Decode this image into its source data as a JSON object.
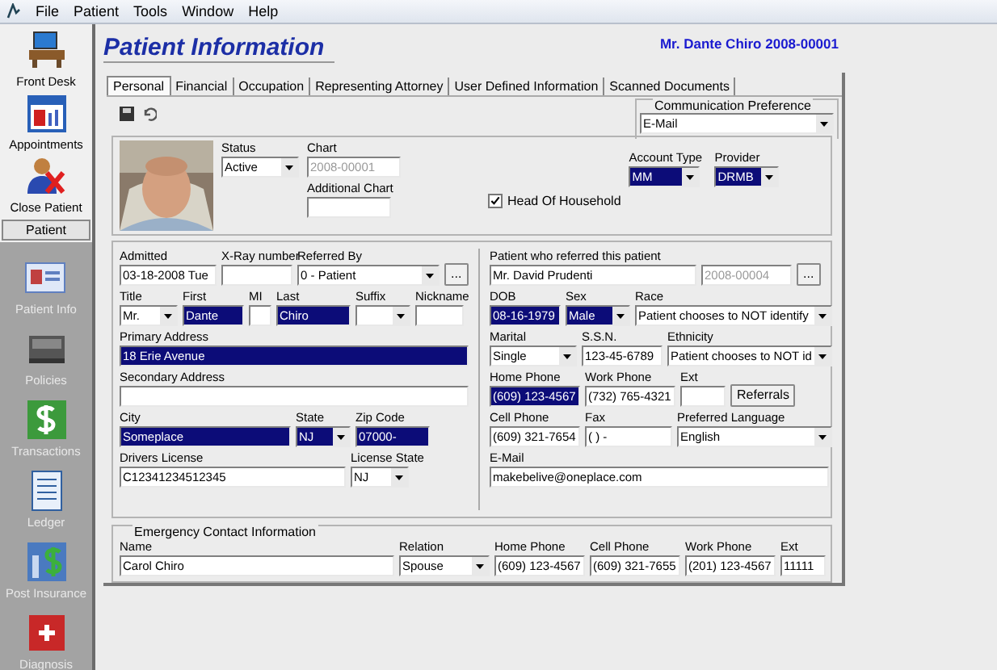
{
  "menu": [
    "File",
    "Patient",
    "Tools",
    "Window",
    "Help"
  ],
  "sidebar": {
    "top_items": [
      {
        "label": "Front Desk"
      },
      {
        "label": "Appointments"
      },
      {
        "label": "Close Patient"
      }
    ],
    "section": "Patient",
    "items": [
      {
        "label": "Patient Info"
      },
      {
        "label": "Policies"
      },
      {
        "label": "Transactions"
      },
      {
        "label": "Ledger"
      },
      {
        "label": "Post Insurance"
      },
      {
        "label": "Diagnosis"
      }
    ]
  },
  "header": {
    "title": "Patient Information",
    "patient": "Mr. Dante Chiro 2008-00001"
  },
  "tabs": [
    {
      "label": "Personal",
      "selected": true
    },
    {
      "label": "Financial",
      "selected": false
    },
    {
      "label": "Occupation",
      "selected": false
    },
    {
      "label": "Representing Attorney",
      "selected": false
    },
    {
      "label": "User Defined Information",
      "selected": false
    },
    {
      "label": "Scanned Documents",
      "selected": false
    }
  ],
  "communication_preference": {
    "label": "Communication Preference",
    "value": "E-Mail"
  },
  "profile": {
    "status": {
      "kind": "select",
      "label": "Status",
      "value": "Active"
    },
    "chart": {
      "kind": "text",
      "label": "Chart",
      "value": "2008-00001",
      "readonly": true
    },
    "additional_chart": {
      "kind": "text",
      "label": "Additional Chart"
    },
    "head_of_household": {
      "label": "Head Of Household",
      "checked": true
    },
    "account_type": {
      "kind": "select",
      "label": "Account Type",
      "value": "MM",
      "highlighted": true
    },
    "provider": {
      "kind": "select",
      "label": "Provider",
      "value": "DRMB",
      "highlighted": true
    }
  },
  "referral_left": [
    {
      "kind": "text",
      "label": "Admitted",
      "value": "03-18-2008 Tue"
    },
    {
      "kind": "text",
      "label": "X-Ray number"
    },
    {
      "kind": "select",
      "label": "Referred By",
      "value": "0 - Patient"
    },
    {
      "kind": "button",
      "text": "..."
    }
  ],
  "referral_right": [
    {
      "kind": "text",
      "label": "Patient who referred this patient",
      "value": "Mr. David Prudenti"
    },
    {
      "kind": "text",
      "value": "2008-00004",
      "readonly": true
    },
    {
      "kind": "button",
      "text": "..."
    }
  ],
  "left_rows": [
    [
      {
        "kind": "select",
        "label": "Title",
        "value": "Mr."
      },
      {
        "kind": "text",
        "label": "First",
        "value": "Dante",
        "highlighted": true
      },
      {
        "kind": "text",
        "label": "MI"
      },
      {
        "kind": "text",
        "label": "Last",
        "value": "Chiro",
        "highlighted": true
      },
      {
        "kind": "select",
        "label": "Suffix"
      },
      {
        "kind": "text",
        "label": "Nickname"
      }
    ],
    [
      {
        "kind": "text",
        "label": "Primary Address",
        "value": "18 Erie Avenue",
        "highlighted": true
      }
    ],
    [
      {
        "kind": "text",
        "label": "Secondary Address"
      }
    ],
    [
      {
        "kind": "text",
        "label": "City",
        "value": "Someplace",
        "highlighted": true
      },
      {
        "kind": "select",
        "label": "State",
        "value": "NJ",
        "highlighted": true
      },
      {
        "kind": "text",
        "label": "Zip Code",
        "value": "07000-",
        "highlighted": true
      }
    ],
    [
      {
        "kind": "text",
        "label": "Drivers License",
        "value": "C12341234512345"
      },
      {
        "kind": "select",
        "label": "License State",
        "value": "NJ"
      }
    ]
  ],
  "right_rows": [
    [
      {
        "kind": "text",
        "label": "DOB",
        "value": "08-16-1979",
        "highlighted": true
      },
      {
        "kind": "select",
        "label": "Sex",
        "value": "Male",
        "highlighted": true
      },
      {
        "kind": "select",
        "label": "Race",
        "value": "Patient chooses to NOT identify"
      }
    ],
    [
      {
        "kind": "select",
        "label": "Marital",
        "value": "Single"
      },
      {
        "kind": "text",
        "label": "S.S.N.",
        "value": "123-45-6789"
      },
      {
        "kind": "select",
        "label": "Ethnicity",
        "value": "Patient chooses to NOT id"
      }
    ],
    [
      {
        "kind": "text",
        "label": "Home Phone",
        "value": "(609) 123-4567",
        "highlighted": true
      },
      {
        "kind": "text",
        "label": "Work Phone",
        "value": "(732) 765-4321"
      },
      {
        "kind": "text",
        "label": "Ext"
      },
      {
        "kind": "button",
        "text": "Referrals"
      }
    ],
    [
      {
        "kind": "text",
        "label": "Cell Phone",
        "value": "(609) 321-7654"
      },
      {
        "kind": "text",
        "label": "Fax",
        "value": "(   )    -"
      },
      {
        "kind": "select",
        "label": "Preferred Language",
        "value": "English"
      }
    ],
    [
      {
        "kind": "text",
        "label": "E-Mail",
        "value": "makebelive@oneplace.com"
      }
    ]
  ],
  "emergency": {
    "title": "Emergency Contact Information",
    "fields": [
      {
        "kind": "text",
        "label": "Name",
        "value": "Carol Chiro"
      },
      {
        "kind": "select",
        "label": "Relation",
        "value": "Spouse"
      },
      {
        "kind": "text",
        "label": "Home Phone",
        "value": "(609) 123-4567"
      },
      {
        "kind": "text",
        "label": "Cell Phone",
        "value": "(609) 321-7655"
      },
      {
        "kind": "text",
        "label": "Work Phone",
        "value": "(201) 123-4567"
      },
      {
        "kind": "text",
        "label": "Ext",
        "value": "11111"
      }
    ]
  }
}
